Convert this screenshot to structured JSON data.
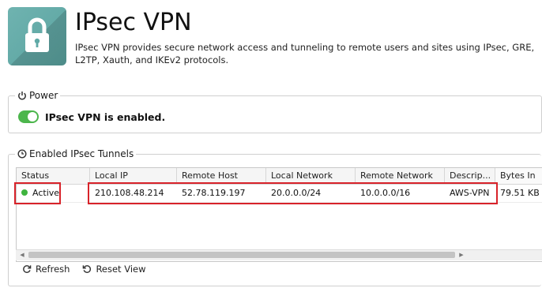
{
  "header": {
    "title": "IPsec VPN",
    "description": "IPsec VPN provides secure network access and tunneling to remote users and sites using IPsec, GRE, L2TP, Xauth, and IKEv2 protocols.",
    "icon": "lock-icon",
    "icon_color": "#5fa9a6"
  },
  "power": {
    "legend": "Power",
    "legend_icon": "power-icon",
    "toggle_state": "on",
    "toggle_color": "#4cb64c",
    "status_text": "IPsec VPN is enabled."
  },
  "tunnels": {
    "legend": "Enabled IPsec Tunnels",
    "legend_icon": "clock-icon",
    "columns": [
      "Status",
      "Local IP",
      "Remote Host",
      "Local Network",
      "Remote Network",
      "Descrip...",
      "Bytes In"
    ],
    "rows": [
      {
        "status": "Active",
        "status_color": "#3fb43f",
        "local_ip": "210.108.48.214",
        "remote_host": "52.78.119.197",
        "local_network": "20.0.0.0/24",
        "remote_network": "10.0.0.0/16",
        "description": "AWS-VPN",
        "bytes_in": "79.51 KB"
      }
    ],
    "highlight_color": "#d8232a"
  },
  "toolbar": {
    "refresh_label": "Refresh",
    "reset_label": "Reset View"
  }
}
